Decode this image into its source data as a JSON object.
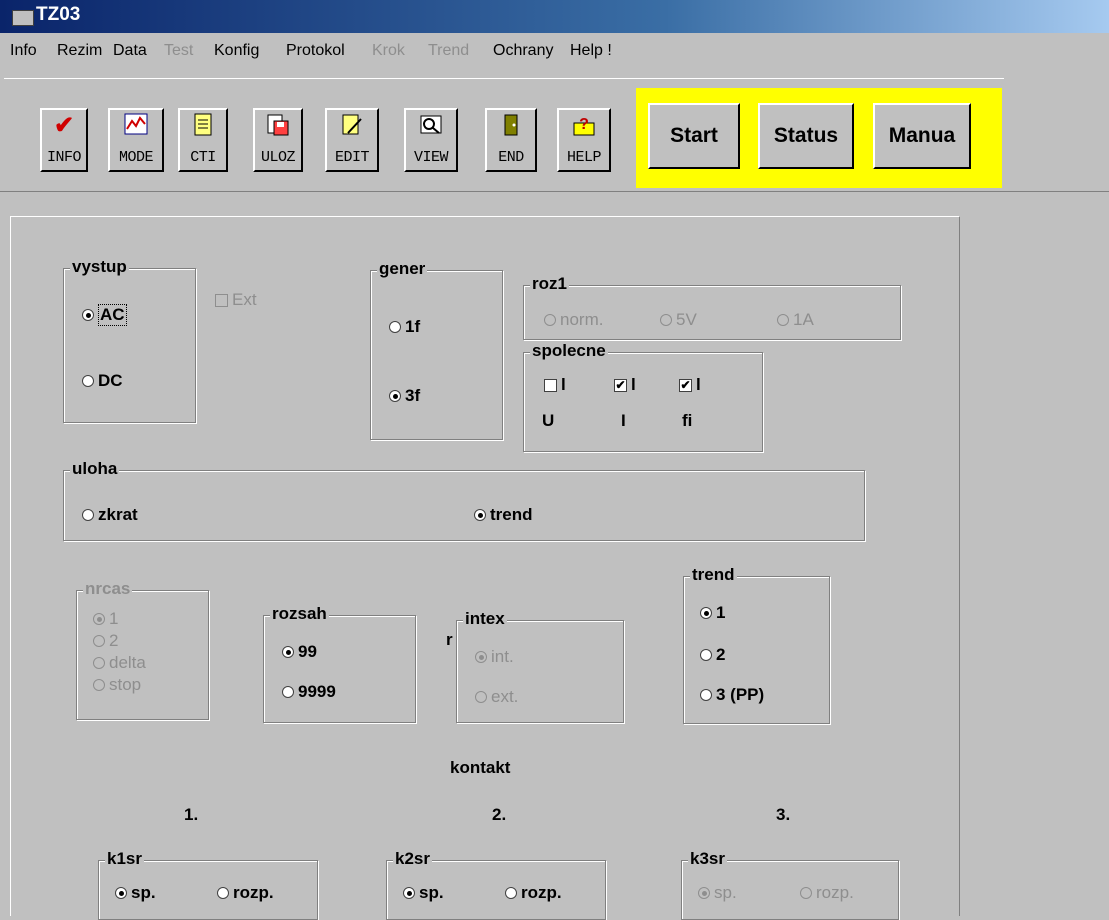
{
  "window": {
    "title": "TZ03"
  },
  "menu": [
    {
      "label": "Info",
      "enabled": true
    },
    {
      "label": "Rezim",
      "enabled": true
    },
    {
      "label": "Data",
      "enabled": true
    },
    {
      "label": "Test",
      "enabled": false
    },
    {
      "label": "Konfig",
      "enabled": true
    },
    {
      "label": "Protokol",
      "enabled": true
    },
    {
      "label": "Krok",
      "enabled": false
    },
    {
      "label": "Trend",
      "enabled": false
    },
    {
      "label": "Ochrany",
      "enabled": true
    },
    {
      "label": "Help !",
      "enabled": true
    }
  ],
  "toolbar": [
    {
      "label": "INFO",
      "icon": "checkmark-icon",
      "glyph": "✔",
      "color": "#d00000"
    },
    {
      "label": "MODE",
      "icon": "chart-icon",
      "glyph": "📈",
      "color": "#000080"
    },
    {
      "label": "CTI",
      "icon": "document-icon",
      "glyph": "🗎",
      "color": "#000000"
    },
    {
      "label": "ULOZ",
      "icon": "save-icon",
      "glyph": "💾",
      "color": "#000000"
    },
    {
      "label": "EDIT",
      "icon": "edit-icon",
      "glyph": "✎",
      "color": "#000000"
    },
    {
      "label": "VIEW",
      "icon": "view-icon",
      "glyph": "👁",
      "color": "#000000"
    },
    {
      "label": "END",
      "icon": "door-icon",
      "glyph": "⏏",
      "color": "#000000"
    },
    {
      "label": "HELP",
      "icon": "help-icon",
      "glyph": "?",
      "color": "#c00000"
    }
  ],
  "actions": {
    "start": "Start",
    "status": "Status",
    "manual": "Manua",
    "highlight_color": "#ffff00"
  },
  "vystup": {
    "title": "vystup",
    "ac": "AC",
    "dc": "DC",
    "selected": "AC",
    "ext_label": "Ext"
  },
  "gener": {
    "title": "gener",
    "opt1": "1f",
    "opt2": "3f",
    "selected": "3f"
  },
  "roz1": {
    "title": "roz1",
    "opt1": "norm.",
    "opt2": "5V",
    "opt3": "1A"
  },
  "spolecne": {
    "title": "spolecne",
    "mark": "l",
    "labels": [
      "U",
      "I",
      "fi"
    ],
    "checked": [
      false,
      true,
      true
    ]
  },
  "uloha": {
    "title": "uloha",
    "opt1": "zkrat",
    "opt2": "trend",
    "selected": "trend"
  },
  "nrcas": {
    "title": "nrcas",
    "opts": [
      "1",
      "2",
      "delta",
      "stop"
    ]
  },
  "rozsah": {
    "title": "rozsah",
    "opt1": "99",
    "opt2": "9999",
    "selected": "99"
  },
  "stray_r": "r",
  "intex": {
    "title": "intex",
    "opt1": "int.",
    "opt2": "ext."
  },
  "trend": {
    "title": "trend",
    "opts": [
      "1",
      "2",
      "3 (PP)"
    ],
    "selected": "1"
  },
  "kontakt": {
    "title": "kontakt",
    "numbers": [
      "1.",
      "2.",
      "3."
    ],
    "groups": [
      {
        "title": "k1sr",
        "opt1": "sp.",
        "opt2": "rozp."
      },
      {
        "title": "k2sr",
        "opt1": "sp.",
        "opt2": "rozp."
      },
      {
        "title": "k3sr",
        "opt1": "sp.",
        "opt2": "rozp."
      }
    ]
  }
}
